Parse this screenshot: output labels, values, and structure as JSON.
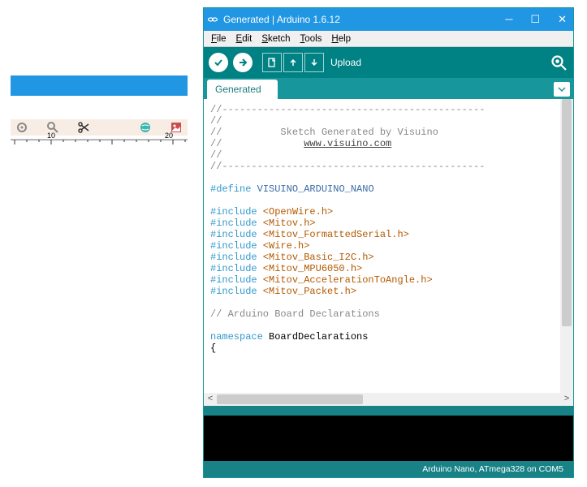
{
  "titlebar": {
    "title": "Generated | Arduino 1.6.12"
  },
  "menu": {
    "file": "File",
    "edit": "Edit",
    "sketch": "Sketch",
    "tools": "Tools",
    "help": "Help"
  },
  "toolbar": {
    "action_label": "Upload"
  },
  "tab": {
    "name": "Generated"
  },
  "code": {
    "l1": "//---------------------------------------------",
    "l2": "//",
    "l3_a": "//          ",
    "l3_b": "Sketch Generated by Visuino",
    "l4_a": "//              ",
    "l4_b": "www.visuino.com",
    "l5": "//",
    "l6": "//---------------------------------------------",
    "l7": " ",
    "l8_a": "#define",
    "l8_b": " VISUINO_ARDUINO_NANO",
    "l9": " ",
    "inc": "#include",
    "l10": " <OpenWire.h>",
    "l11": " <Mitov.h>",
    "l12": " <Mitov_FormattedSerial.h>",
    "l13": " <Wire.h>",
    "l14": " <Mitov_Basic_I2C.h>",
    "l15": " <Mitov_MPU6050.h>",
    "l16": " <Mitov_AccelerationToAngle.h>",
    "l17": " <Mitov_Packet.h>",
    "l18": " ",
    "l19": "// Arduino Board Declarations",
    "l20": " ",
    "l21_a": "namespace",
    "l21_b": " BoardDeclarations",
    "l22": "{"
  },
  "status": {
    "text": "Arduino Nano, ATmega328 on COM5"
  },
  "ruler": {
    "n10": "10",
    "n20": "20"
  }
}
